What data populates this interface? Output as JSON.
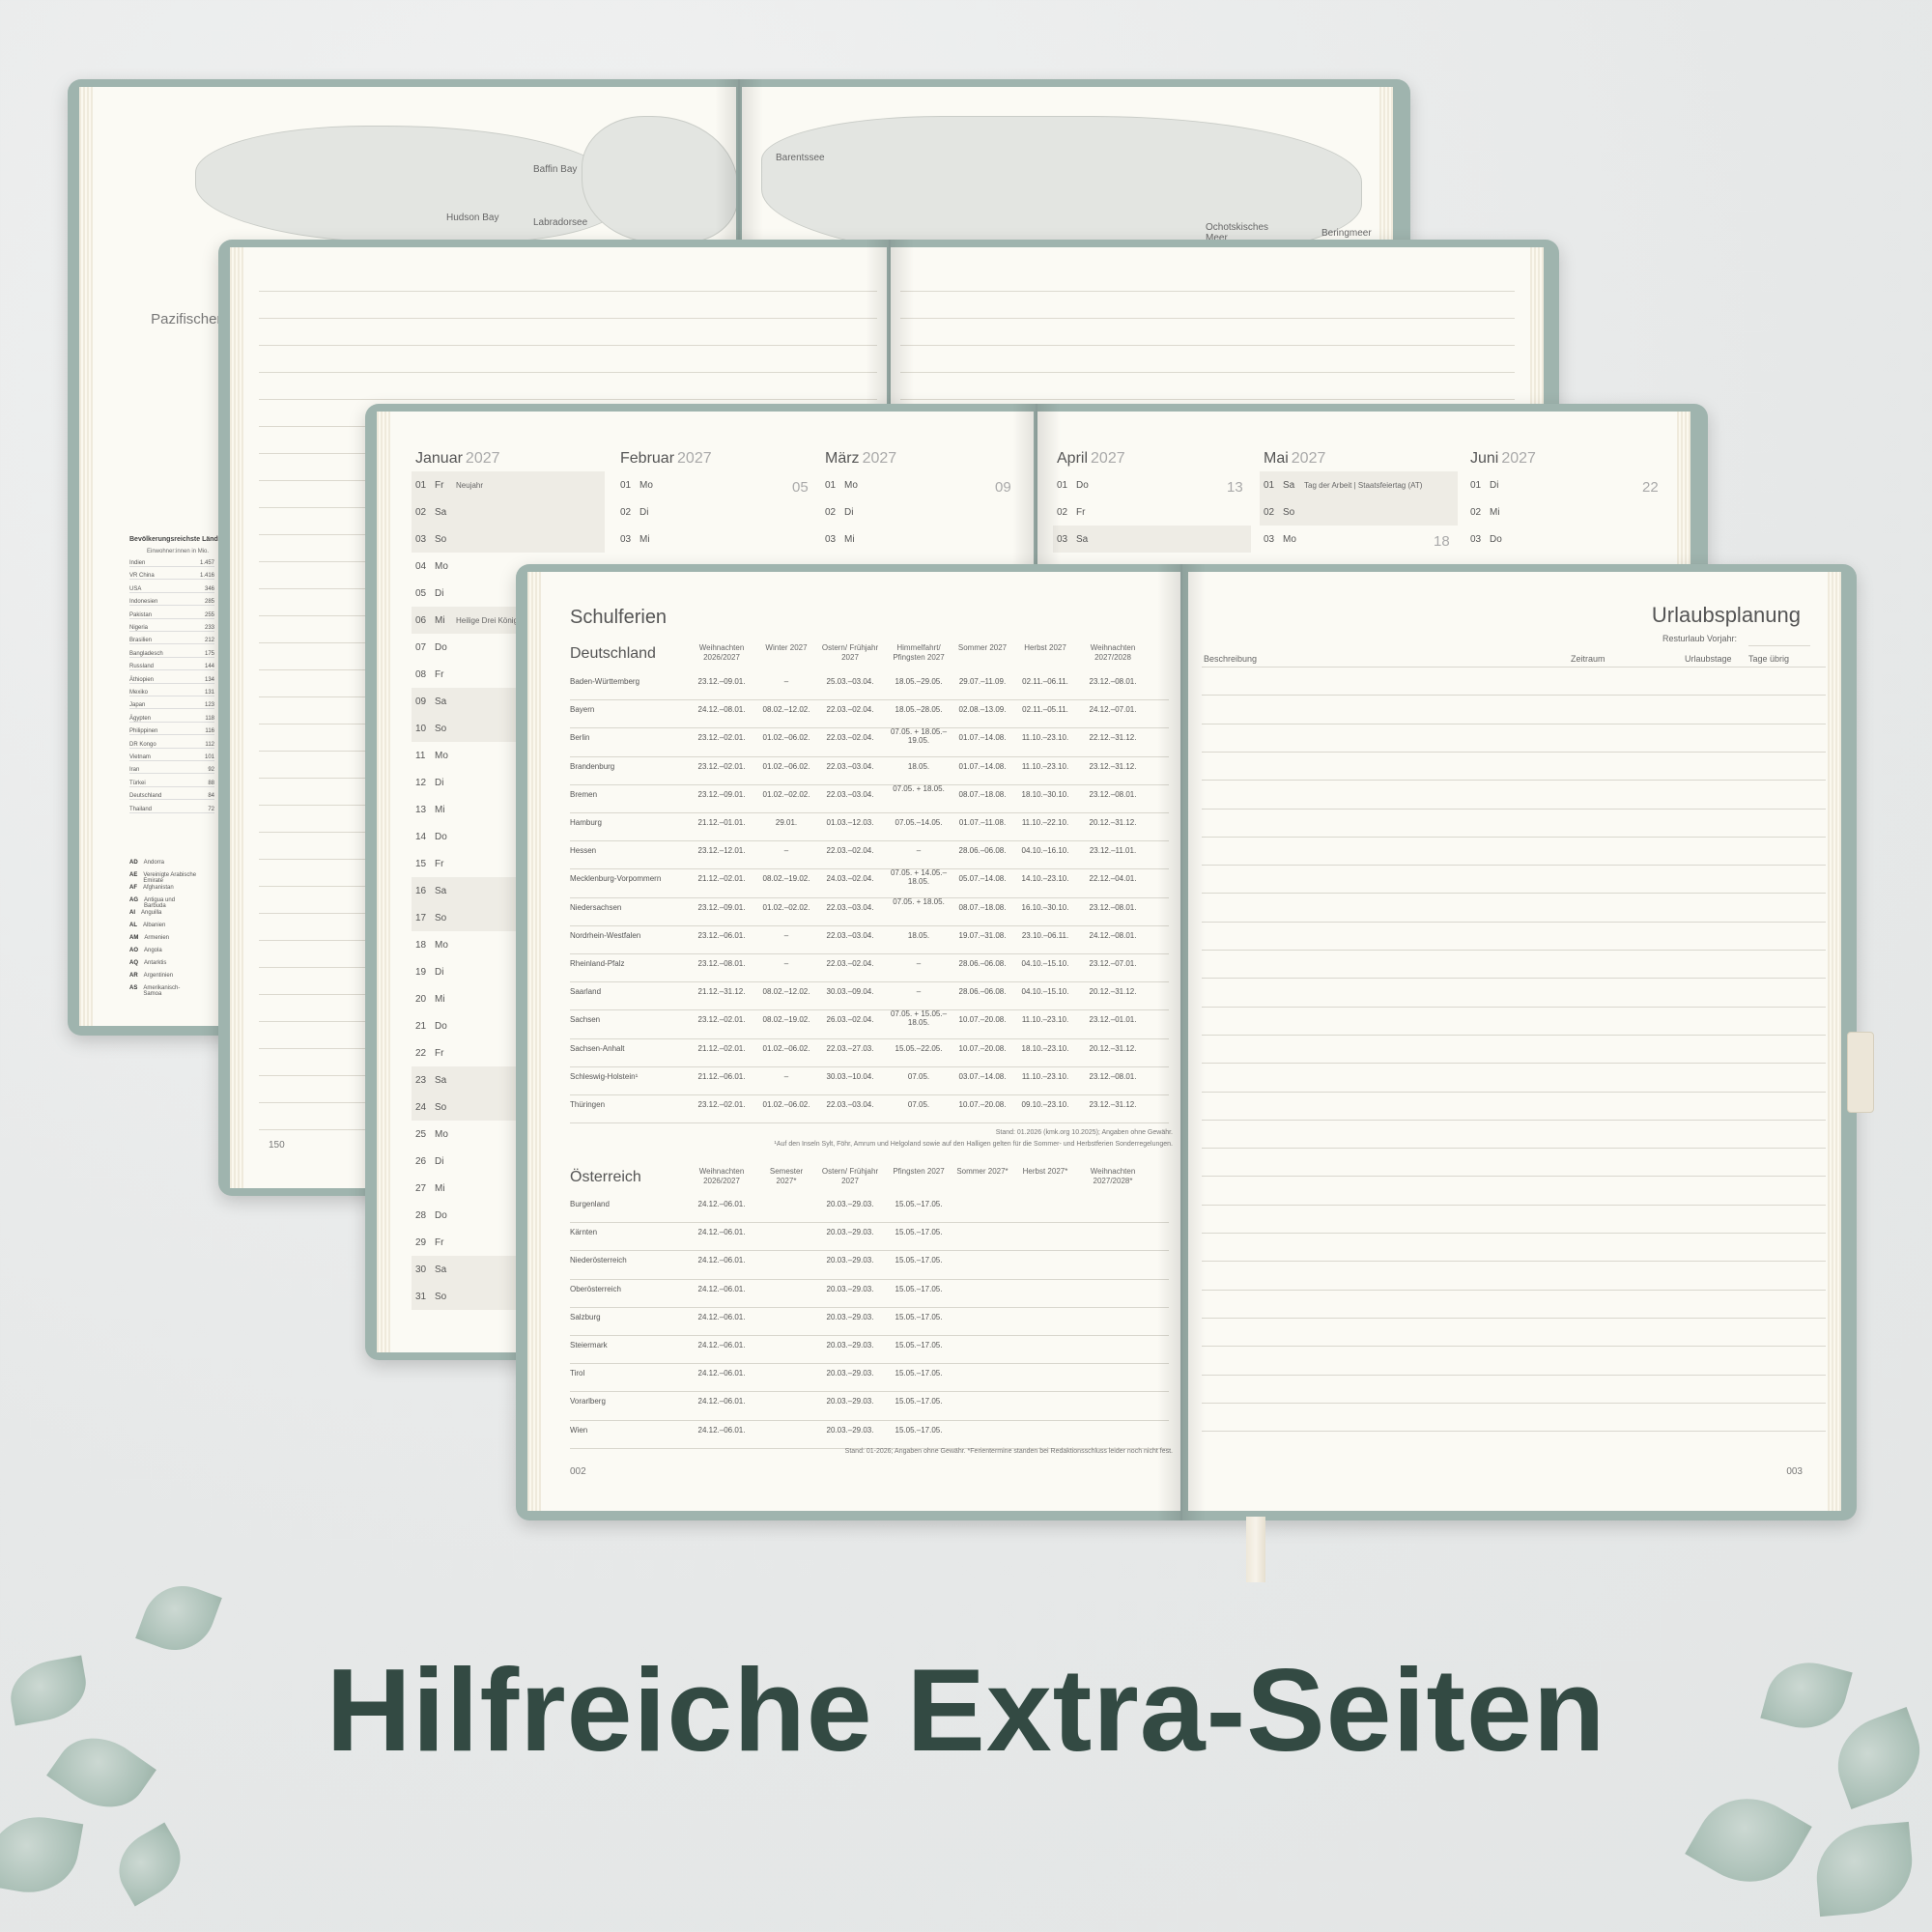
{
  "headline": "Hilfreiche Extra-Seiten",
  "book_map": {
    "labels": [
      "Baffin Bay",
      "Hudson Bay",
      "Labradorsee",
      "Barentssee",
      "Ochotskisches Meer",
      "Beringmeer"
    ],
    "ocean": "Pazifischer Ozean",
    "population_title": "Bevölkerungsreichste Länder",
    "population_sub": "Einwohner:innen in Mio.",
    "population": [
      {
        "country": "Indien",
        "value": "1.457"
      },
      {
        "country": "VR China",
        "value": "1.416"
      },
      {
        "country": "USA",
        "value": "346"
      },
      {
        "country": "Indonesien",
        "value": "285"
      },
      {
        "country": "Pakistan",
        "value": "255"
      },
      {
        "country": "Nigeria",
        "value": "233"
      },
      {
        "country": "Brasilien",
        "value": "212"
      },
      {
        "country": "Bangladesch",
        "value": "175"
      },
      {
        "country": "Russland",
        "value": "144"
      },
      {
        "country": "Äthiopien",
        "value": "134"
      },
      {
        "country": "Mexiko",
        "value": "131"
      },
      {
        "country": "Japan",
        "value": "123"
      },
      {
        "country": "Ägypten",
        "value": "118"
      },
      {
        "country": "Philippinen",
        "value": "116"
      },
      {
        "country": "DR Kongo",
        "value": "112"
      },
      {
        "country": "Vietnam",
        "value": "101"
      },
      {
        "country": "Iran",
        "value": "92"
      },
      {
        "country": "Türkei",
        "value": "88"
      },
      {
        "country": "Deutschland",
        "value": "84"
      },
      {
        "country": "Thailand",
        "value": "72"
      }
    ],
    "codes": [
      {
        "code": "AD",
        "name": "Andorra"
      },
      {
        "code": "AE",
        "name": "Vereinigte Arabische Emirate"
      },
      {
        "code": "AF",
        "name": "Afghanistan"
      },
      {
        "code": "AG",
        "name": "Antigua und Barbuda"
      },
      {
        "code": "AI",
        "name": "Anguilla"
      },
      {
        "code": "AL",
        "name": "Albanien"
      },
      {
        "code": "AM",
        "name": "Armenien"
      },
      {
        "code": "AO",
        "name": "Angola"
      },
      {
        "code": "AQ",
        "name": "Antarktis"
      },
      {
        "code": "AR",
        "name": "Argentinien"
      },
      {
        "code": "AS",
        "name": "Amerikanisch-Samoa"
      }
    ]
  },
  "book_lined": {
    "page_number": "150"
  },
  "book_calendar": {
    "months": [
      {
        "name": "Januar",
        "year": "2027"
      },
      {
        "name": "Februar",
        "year": "2027",
        "week": "05"
      },
      {
        "name": "März",
        "year": "2027",
        "week": "09"
      },
      {
        "name": "April",
        "year": "2027",
        "week": "13"
      },
      {
        "name": "Mai",
        "year": "2027",
        "week": "18"
      },
      {
        "name": "Juni",
        "year": "2027",
        "week": "22"
      }
    ],
    "january": [
      {
        "d": "01",
        "w": "Fr",
        "e": "Neujahr"
      },
      {
        "d": "02",
        "w": "Sa",
        "e": ""
      },
      {
        "d": "03",
        "w": "So",
        "e": ""
      },
      {
        "d": "04",
        "w": "Mo",
        "e": ""
      },
      {
        "d": "05",
        "w": "Di",
        "e": ""
      },
      {
        "d": "06",
        "w": "Mi",
        "e": "Heilige Drei Könige"
      },
      {
        "d": "07",
        "w": "Do",
        "e": ""
      },
      {
        "d": "08",
        "w": "Fr",
        "e": ""
      },
      {
        "d": "09",
        "w": "Sa",
        "e": ""
      },
      {
        "d": "10",
        "w": "So",
        "e": ""
      },
      {
        "d": "11",
        "w": "Mo",
        "e": ""
      },
      {
        "d": "12",
        "w": "Di",
        "e": ""
      },
      {
        "d": "13",
        "w": "Mi",
        "e": ""
      },
      {
        "d": "14",
        "w": "Do",
        "e": ""
      },
      {
        "d": "15",
        "w": "Fr",
        "e": ""
      },
      {
        "d": "16",
        "w": "Sa",
        "e": ""
      },
      {
        "d": "17",
        "w": "So",
        "e": ""
      },
      {
        "d": "18",
        "w": "Mo",
        "e": ""
      },
      {
        "d": "19",
        "w": "Di",
        "e": ""
      },
      {
        "d": "20",
        "w": "Mi",
        "e": ""
      },
      {
        "d": "21",
        "w": "Do",
        "e": ""
      },
      {
        "d": "22",
        "w": "Fr",
        "e": ""
      },
      {
        "d": "23",
        "w": "Sa",
        "e": ""
      },
      {
        "d": "24",
        "w": "So",
        "e": ""
      },
      {
        "d": "25",
        "w": "Mo",
        "e": ""
      },
      {
        "d": "26",
        "w": "Di",
        "e": ""
      },
      {
        "d": "27",
        "w": "Mi",
        "e": ""
      },
      {
        "d": "28",
        "w": "Do",
        "e": ""
      },
      {
        "d": "29",
        "w": "Fr",
        "e": ""
      },
      {
        "d": "30",
        "w": "Sa",
        "e": ""
      },
      {
        "d": "31",
        "w": "So",
        "e": ""
      }
    ],
    "february": [
      {
        "d": "01",
        "w": "Mo"
      },
      {
        "d": "02",
        "w": "Di"
      },
      {
        "d": "03",
        "w": "Mi"
      }
    ],
    "march": [
      {
        "d": "01",
        "w": "Mo"
      },
      {
        "d": "02",
        "w": "Di"
      },
      {
        "d": "03",
        "w": "Mi"
      }
    ],
    "april": [
      {
        "d": "01",
        "w": "Do"
      },
      {
        "d": "02",
        "w": "Fr"
      },
      {
        "d": "03",
        "w": "Sa"
      }
    ],
    "may": [
      {
        "d": "01",
        "w": "Sa",
        "e": "Tag der Arbeit | Staatsfeiertag (AT)"
      },
      {
        "d": "02",
        "w": "So",
        "e": ""
      },
      {
        "d": "03",
        "w": "Mo",
        "e": ""
      }
    ],
    "june": [
      {
        "d": "01",
        "w": "Di"
      },
      {
        "d": "02",
        "w": "Mi"
      },
      {
        "d": "03",
        "w": "Do"
      }
    ]
  },
  "schulferien": {
    "title": "Schulferien",
    "de_title": "Deutschland",
    "de_headers": [
      "Weihnachten 2026/2027",
      "Winter 2027",
      "Ostern/ Frühjahr 2027",
      "Himmelfahrt/ Pfingsten 2027",
      "Sommer 2027",
      "Herbst 2027",
      "Weihnachten 2027/2028"
    ],
    "de_rows": [
      [
        "Baden-Württemberg",
        "23.12.–09.01.",
        "–",
        "25.03.–03.04.",
        "18.05.–29.05.",
        "29.07.–11.09.",
        "02.11.–06.11.",
        "23.12.–08.01."
      ],
      [
        "Bayern",
        "24.12.–08.01.",
        "08.02.–12.02.",
        "22.03.–02.04.",
        "18.05.–28.05.",
        "02.08.–13.09.",
        "02.11.–05.11.",
        "24.12.–07.01."
      ],
      [
        "Berlin",
        "23.12.–02.01.",
        "01.02.–06.02.",
        "22.03.–02.04.",
        "07.05. + 18.05.– 19.05.",
        "01.07.–14.08.",
        "11.10.–23.10.",
        "22.12.–31.12."
      ],
      [
        "Brandenburg",
        "23.12.–02.01.",
        "01.02.–06.02.",
        "22.03.–03.04.",
        "18.05.",
        "01.07.–14.08.",
        "11.10.–23.10.",
        "23.12.–31.12."
      ],
      [
        "Bremen",
        "23.12.–09.01.",
        "01.02.–02.02.",
        "22.03.–03.04.",
        "07.05. + 18.05.",
        "08.07.–18.08.",
        "18.10.–30.10.",
        "23.12.–08.01."
      ],
      [
        "Hamburg",
        "21.12.–01.01.",
        "29.01.",
        "01.03.–12.03.",
        "07.05.–14.05.",
        "01.07.–11.08.",
        "11.10.–22.10.",
        "20.12.–31.12."
      ],
      [
        "Hessen",
        "23.12.–12.01.",
        "–",
        "22.03.–02.04.",
        "–",
        "28.06.–06.08.",
        "04.10.–16.10.",
        "23.12.–11.01."
      ],
      [
        "Mecklenburg-Vorpommern",
        "21.12.–02.01.",
        "08.02.–19.02.",
        "24.03.–02.04.",
        "07.05. + 14.05.– 18.05.",
        "05.07.–14.08.",
        "14.10.–23.10.",
        "22.12.–04.01."
      ],
      [
        "Niedersachsen",
        "23.12.–09.01.",
        "01.02.–02.02.",
        "22.03.–03.04.",
        "07.05. + 18.05.",
        "08.07.–18.08.",
        "16.10.–30.10.",
        "23.12.–08.01."
      ],
      [
        "Nordrhein-Westfalen",
        "23.12.–06.01.",
        "–",
        "22.03.–03.04.",
        "18.05.",
        "19.07.–31.08.",
        "23.10.–06.11.",
        "24.12.–08.01."
      ],
      [
        "Rheinland-Pfalz",
        "23.12.–08.01.",
        "–",
        "22.03.–02.04.",
        "–",
        "28.06.–06.08.",
        "04.10.–15.10.",
        "23.12.–07.01."
      ],
      [
        "Saarland",
        "21.12.–31.12.",
        "08.02.–12.02.",
        "30.03.–09.04.",
        "–",
        "28.06.–06.08.",
        "04.10.–15.10.",
        "20.12.–31.12."
      ],
      [
        "Sachsen",
        "23.12.–02.01.",
        "08.02.–19.02.",
        "26.03.–02.04.",
        "07.05. + 15.05.– 18.05.",
        "10.07.–20.08.",
        "11.10.–23.10.",
        "23.12.–01.01."
      ],
      [
        "Sachsen-Anhalt",
        "21.12.–02.01.",
        "01.02.–06.02.",
        "22.03.–27.03.",
        "15.05.–22.05.",
        "10.07.–20.08.",
        "18.10.–23.10.",
        "20.12.–31.12."
      ],
      [
        "Schleswig-Holstein¹",
        "21.12.–06.01.",
        "–",
        "30.03.–10.04.",
        "07.05.",
        "03.07.–14.08.",
        "11.10.–23.10.",
        "23.12.–08.01."
      ],
      [
        "Thüringen",
        "23.12.–02.01.",
        "01.02.–06.02.",
        "22.03.–03.04.",
        "07.05.",
        "10.07.–20.08.",
        "09.10.–23.10.",
        "23.12.–31.12."
      ]
    ],
    "de_foot1": "Stand: 01.2026 (kmk.org 10.2025); Angaben ohne Gewähr.",
    "de_foot2": "¹Auf den Inseln Sylt, Föhr, Amrum und Helgoland sowie auf den Halligen gelten für die Sommer- und Herbstferien Sonderregelungen.",
    "at_title": "Österreich",
    "at_headers": [
      "Weihnachten 2026/2027",
      "Semester 2027*",
      "Ostern/ Frühjahr 2027",
      "Pfingsten 2027",
      "Sommer 2027*",
      "Herbst 2027*",
      "Weihnachten 2027/2028*"
    ],
    "at_rows": [
      [
        "Burgenland",
        "24.12.–06.01.",
        "",
        "20.03.–29.03.",
        "15.05.–17.05.",
        "",
        "",
        ""
      ],
      [
        "Kärnten",
        "24.12.–06.01.",
        "",
        "20.03.–29.03.",
        "15.05.–17.05.",
        "",
        "",
        ""
      ],
      [
        "Niederösterreich",
        "24.12.–06.01.",
        "",
        "20.03.–29.03.",
        "15.05.–17.05.",
        "",
        "",
        ""
      ],
      [
        "Oberösterreich",
        "24.12.–06.01.",
        "",
        "20.03.–29.03.",
        "15.05.–17.05.",
        "",
        "",
        ""
      ],
      [
        "Salzburg",
        "24.12.–06.01.",
        "",
        "20.03.–29.03.",
        "15.05.–17.05.",
        "",
        "",
        ""
      ],
      [
        "Steiermark",
        "24.12.–06.01.",
        "",
        "20.03.–29.03.",
        "15.05.–17.05.",
        "",
        "",
        ""
      ],
      [
        "Tirol",
        "24.12.–06.01.",
        "",
        "20.03.–29.03.",
        "15.05.–17.05.",
        "",
        "",
        ""
      ],
      [
        "Vorarlberg",
        "24.12.–06.01.",
        "",
        "20.03.–29.03.",
        "15.05.–17.05.",
        "",
        "",
        ""
      ],
      [
        "Wien",
        "24.12.–06.01.",
        "",
        "20.03.–29.03.",
        "15.05.–17.05.",
        "",
        "",
        ""
      ]
    ],
    "at_foot": "Stand: 01-2026; Angaben ohne Gewähr. *Ferientermine standen bei Redaktionsschluss leider noch nicht fest.",
    "page_left": "002"
  },
  "urlaub": {
    "title": "Urlaubsplanung",
    "rest": "Resturlaub Vorjahr:",
    "headers": [
      "Beschreibung",
      "Zeitraum",
      "Urlaubstage",
      "Tage übrig"
    ],
    "page_right": "003"
  }
}
